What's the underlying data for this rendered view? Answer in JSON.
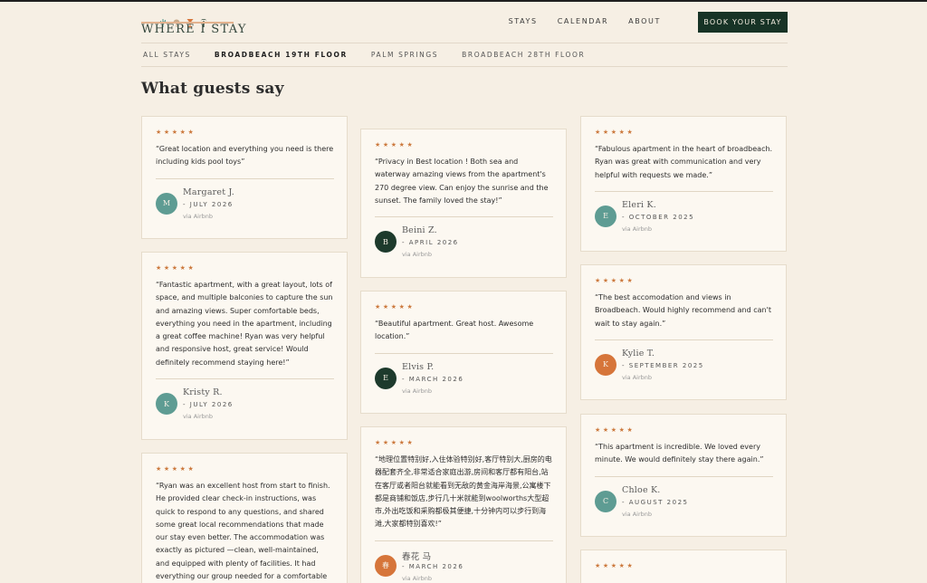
{
  "brand": {
    "name": "WHERE I STAY",
    "colors": {
      "primary": "#173326",
      "accent": "#cc7a3f",
      "background": "#f6efe4",
      "card": "#fcf8f1",
      "teal": "#5e9c93",
      "orange": "#d6753a"
    }
  },
  "nav": {
    "items": [
      "STAYS",
      "CALENDAR",
      "ABOUT"
    ],
    "cta": "BOOK YOUR STAY"
  },
  "subnav": {
    "items": [
      "ALL STAYS",
      "BROADBEACH 19TH FLOOR",
      "PALM SPRINGS",
      "BROADBEACH 28TH FLOOR"
    ],
    "active": "BROADBEACH 19TH FLOOR"
  },
  "section_title": "What guests say",
  "stars_text": "★★★★★",
  "reviews": [
    {
      "quote": "“Great location and everything you need is there including kids pool toys”",
      "name": "Margaret J.",
      "initial": "M",
      "date": "- JULY 2026",
      "via": "via Airbnb",
      "avatar_color": "#5e9c93"
    },
    {
      "quote": "“Fantastic apartment, with a great layout, lots of space, and multiple balconies to capture the sun and amazing views. Super comfortable beds, everything you need in the apartment, including a great coffee machine! Ryan was very helpful and responsive host, great service! Would definitely recommend staying here!”",
      "name": "Kristy R.",
      "initial": "K",
      "date": "- JULY 2026",
      "via": "via Airbnb",
      "avatar_color": "#5e9c93"
    },
    {
      "quote": "“Ryan was an excellent host from start to finish. He provided clear check-in instructions, was quick to respond to any questions, and shared some great local recommendations that made our stay even better. The accommodation was exactly as pictured —clean, well-maintained, and equipped with plenty of facilities. It had everything our group needed for a comfortable and enjoyable stay. The location was"
    },
    {
      "quote": "“Privacy in Best location ! Both sea and waterway amazing views from the apartment's 270 degree view. Can enjoy the sunrise and the sunset. The family loved the stay!”",
      "name": "Beini Z.",
      "initial": "B",
      "date": "- APRIL 2026",
      "via": "via Airbnb",
      "avatar_color": "#1d3a2c"
    },
    {
      "quote": "“Beautiful apartment. Great host. Awesome location.”",
      "name": "Elvis P.",
      "initial": "E",
      "date": "- MARCH 2026",
      "via": "via Airbnb",
      "avatar_color": "#1d3a2c"
    },
    {
      "quote": "“地理位置特别好,入住体验特别好,客厅特别大,厨房的电器配套齐全,非常适合家庭出游,房间和客厅都有阳台,站在客厅或者阳台就能看到无敌的黄金海岸海景,公寓楼下都是商铺和饭店,步行几十米就能到woolworths大型超市,外出吃饭和采购都极其便捷,十分钟内可以步行到海滩,大家都特别喜欢!”",
      "name": "春花 马",
      "initial": "春",
      "date": "- MARCH 2026",
      "via": "via Airbnb",
      "avatar_color": "#d6753a"
    },
    {
      "quote": "“Fabulous apartment in the heart of broadbeach. Ryan was great with communication and very helpful with requests we made.”",
      "name": "Eleri K.",
      "initial": "E",
      "date": "- OCTOBER 2025",
      "via": "via Airbnb",
      "avatar_color": "#5e9c93"
    },
    {
      "quote": "“The best accomodation and views in Broadbeach. Would highly recommend and can't wait to stay again.”",
      "name": "Kylie T.",
      "initial": "K",
      "date": "- SEPTEMBER 2025",
      "via": "via Airbnb",
      "avatar_color": "#d6753a"
    },
    {
      "quote": "“This apartment is incredible. We loved every minute. We would definitely stay there again.”",
      "name": "Chloe K.",
      "initial": "C",
      "date": "- AUGUST 2025",
      "via": "via Airbnb",
      "avatar_color": "#5e9c93"
    },
    {
      "quote": ""
    }
  ]
}
